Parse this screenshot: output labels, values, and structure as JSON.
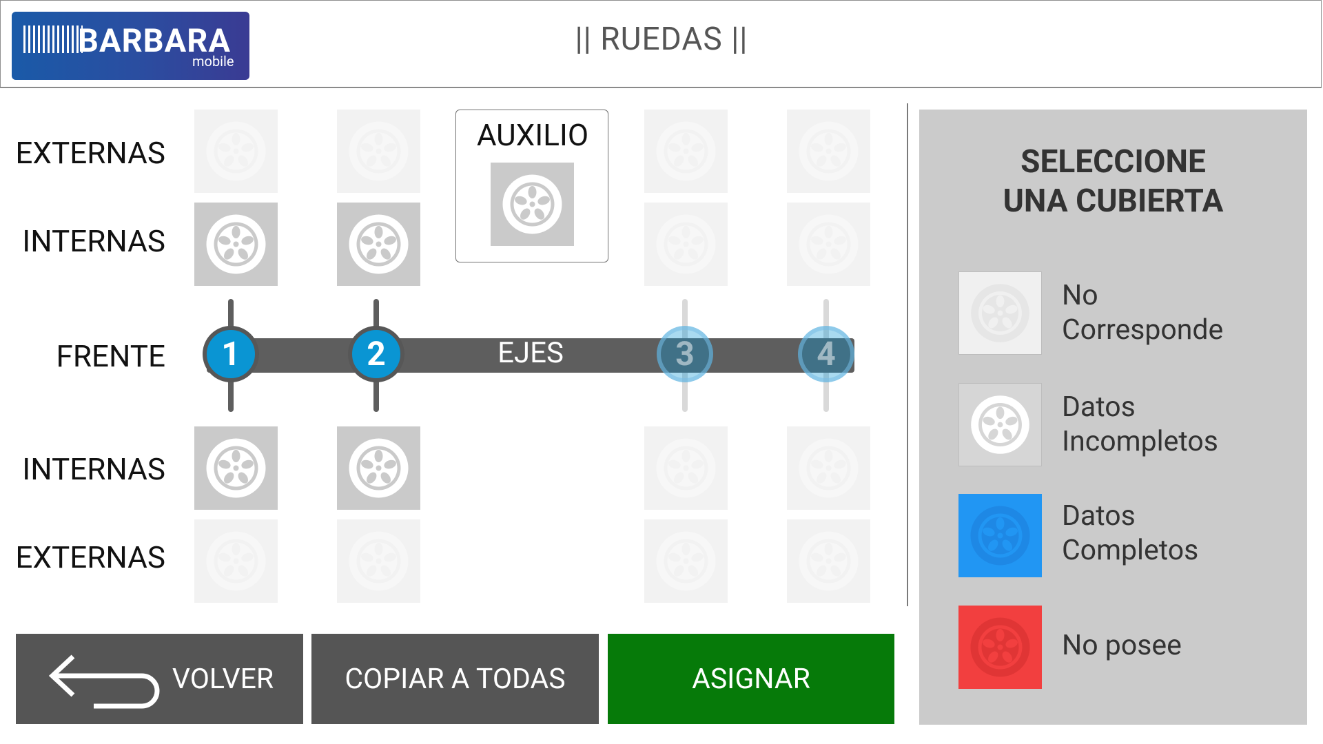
{
  "header": {
    "logo_brand": "BARBARA",
    "logo_sub": "mobile",
    "title": "|| RUEDAS ||"
  },
  "rows": {
    "top_externas": "EXTERNAS",
    "top_internas": "INTERNAS",
    "frente": "FRENTE",
    "bottom_internas": "INTERNAS",
    "bottom_externas": "EXTERNAS"
  },
  "auxilio": {
    "label": "AUXILIO"
  },
  "axle": {
    "label": "EJES",
    "nodes": [
      {
        "number": "1",
        "active": true
      },
      {
        "number": "2",
        "active": true
      },
      {
        "number": "3",
        "active": false
      },
      {
        "number": "4",
        "active": false
      }
    ]
  },
  "buttons": {
    "volver": "VOLVER",
    "copiar": "COPIAR A TODAS",
    "asignar": "ASIGNAR"
  },
  "legend": {
    "title_line1": "SELECCIONE",
    "title_line2": "UNA CUBIERTA",
    "items": [
      {
        "line1": "No",
        "line2": "Corresponde",
        "color": "#f0f0f0"
      },
      {
        "line1": "Datos",
        "line2": "Incompletos",
        "color": "#d6d6d6"
      },
      {
        "line1": "Datos",
        "line2": "Completos",
        "color": "#2196f3"
      },
      {
        "line1": "No posee",
        "line2": "",
        "color": "#f23f3f"
      }
    ]
  },
  "colors": {
    "asignar": "#067a09",
    "dark_button": "#555555",
    "axle_node": "#0a95d3"
  }
}
